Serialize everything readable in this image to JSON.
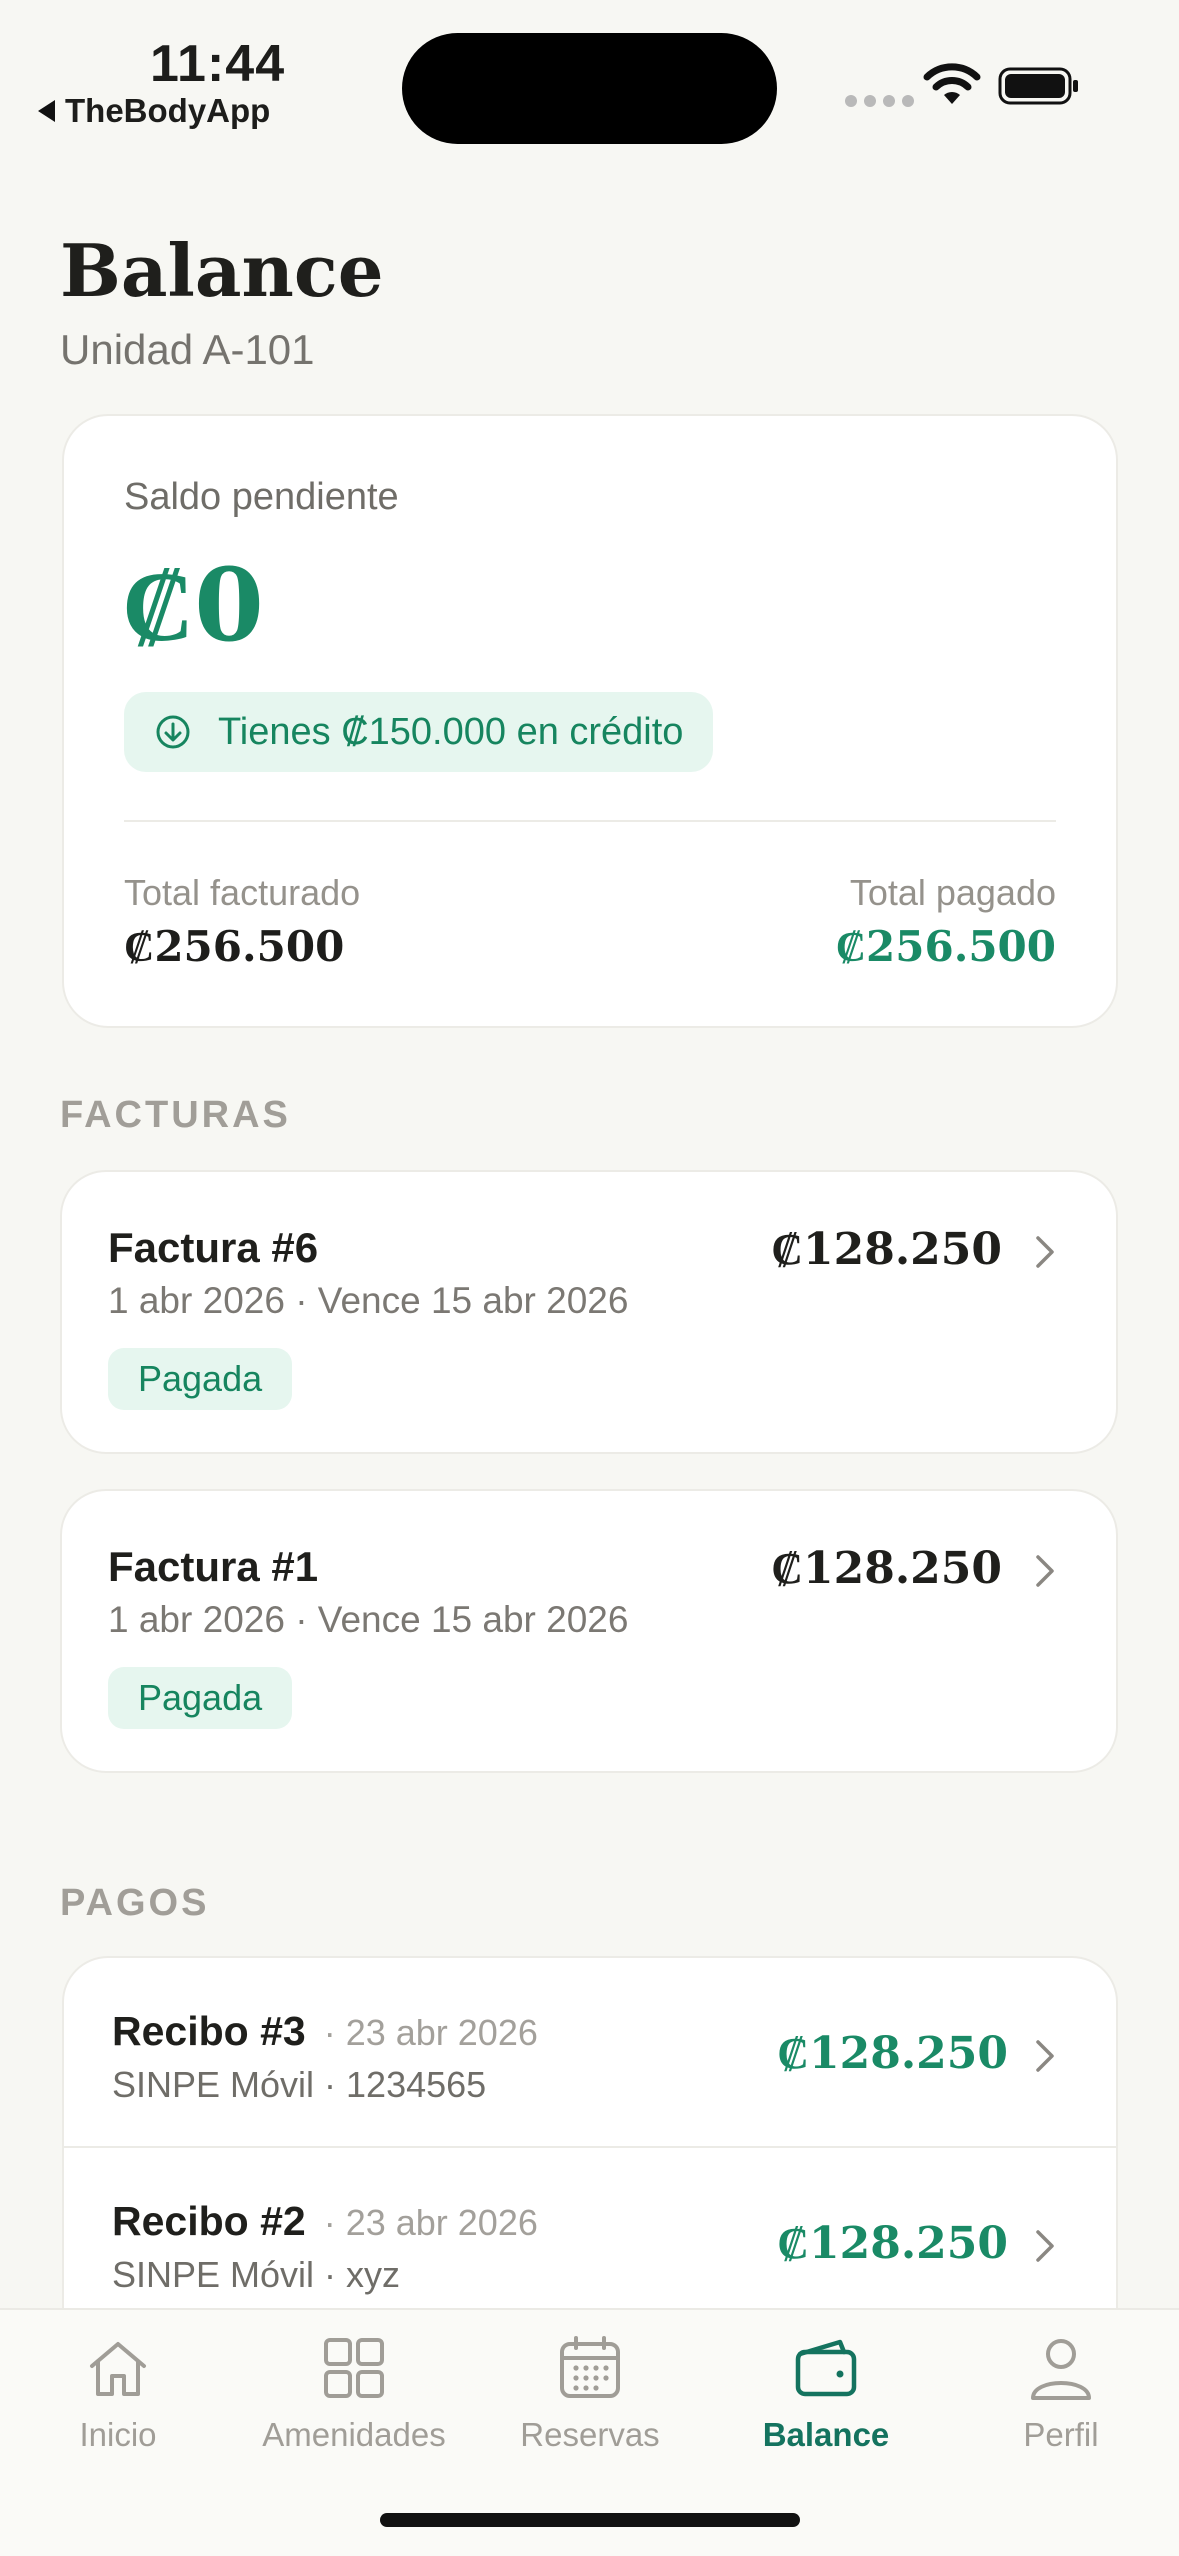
{
  "status_bar": {
    "time": "11:44",
    "back_app": "TheBodyApp"
  },
  "header": {
    "title": "Balance",
    "subtitle": "Unidad A-101"
  },
  "summary": {
    "pending_label": "Saldo pendiente",
    "pending_value": "₡0",
    "credit_text": "Tienes ₡150.000 en crédito",
    "total_billed_label": "Total facturado",
    "total_billed_value": "₡256.500",
    "total_paid_label": "Total pagado",
    "total_paid_value": "₡256.500"
  },
  "invoices_section": "FACTURAS",
  "invoices": [
    {
      "name": "Factura #6",
      "meta": "1 abr 2026 · Vence 15 abr 2026",
      "status": "Pagada",
      "amount": "₡128.250"
    },
    {
      "name": "Factura #1",
      "meta": "1 abr 2026 · Vence 15 abr 2026",
      "status": "Pagada",
      "amount": "₡128.250"
    }
  ],
  "payments_section": "PAGOS",
  "payments": [
    {
      "name": "Recibo #3",
      "date": "· 23 abr 2026",
      "meta": "SINPE Móvil · 1234565",
      "amount": "₡128.250"
    },
    {
      "name": "Recibo #2",
      "date": "· 23 abr 2026",
      "meta": "SINPE Móvil · xyz",
      "amount": "₡128.250"
    }
  ],
  "tabs": [
    {
      "label": "Inicio",
      "icon": "home-icon"
    },
    {
      "label": "Amenidades",
      "icon": "grid-icon"
    },
    {
      "label": "Reservas",
      "icon": "calendar-icon"
    },
    {
      "label": "Balance",
      "icon": "wallet-icon",
      "active": true
    },
    {
      "label": "Perfil",
      "icon": "person-icon"
    }
  ],
  "colors": {
    "accent": "#1a8a66",
    "active_tab": "#14735f",
    "background": "#f7f7f3"
  }
}
